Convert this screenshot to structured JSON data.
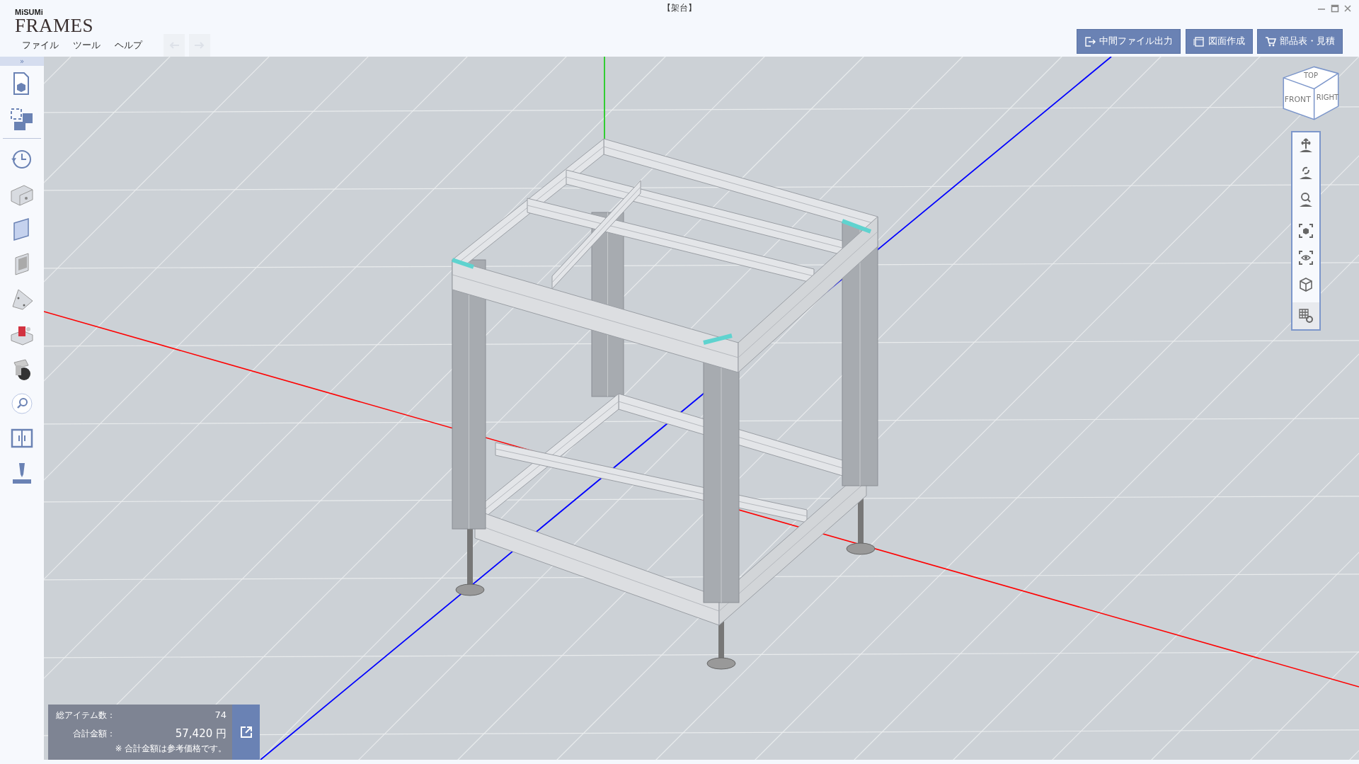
{
  "window": {
    "title": "【架台】"
  },
  "logo": {
    "brand": "MiSUMi",
    "product": "FRAMES"
  },
  "menu": [
    "ファイル",
    "ツール",
    "ヘルプ"
  ],
  "history": [
    {
      "kind": "undo",
      "disabled": true
    },
    {
      "kind": "redo",
      "disabled": true
    }
  ],
  "actions": [
    {
      "kind": "export",
      "label": "中間ファイル出力"
    },
    {
      "kind": "drawing",
      "label": "図面作成"
    },
    {
      "kind": "cart",
      "label": "部品表・見積"
    }
  ],
  "sidebar": {
    "toggle": "»",
    "tools": [
      {
        "kind": "new-file"
      },
      {
        "kind": "layout"
      },
      {
        "kind": "history"
      },
      {
        "kind": "profile"
      },
      {
        "kind": "panel"
      },
      {
        "kind": "mesh"
      },
      {
        "kind": "bracket"
      },
      {
        "kind": "parts"
      },
      {
        "kind": "caster"
      },
      {
        "kind": "search"
      },
      {
        "kind": "door"
      },
      {
        "kind": "drill"
      }
    ]
  },
  "view_cube": {
    "faces": [
      "TOP",
      "FRONT",
      "RIGHT"
    ]
  },
  "view_tools": [
    {
      "kind": "pan"
    },
    {
      "kind": "rotate"
    },
    {
      "kind": "zoom"
    },
    {
      "kind": "fit"
    },
    {
      "kind": "visibility"
    },
    {
      "kind": "view"
    },
    {
      "kind": "grid-settings"
    }
  ],
  "summary": {
    "rows": [
      {
        "label": "総アイテム数：",
        "value": "74"
      },
      {
        "label": "合計金額：",
        "value": "57,420 円"
      }
    ],
    "note": "※ 合計金額は参考価格です。"
  }
}
